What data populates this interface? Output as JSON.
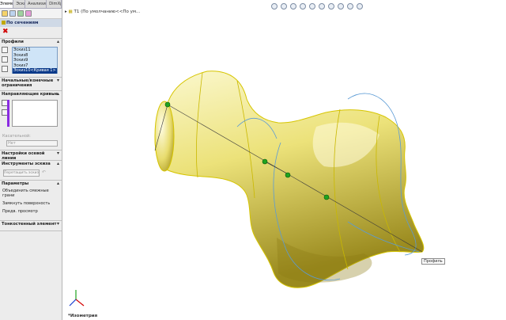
{
  "tabs": [
    "Элементы",
    "Эскиз",
    "Анализировать",
    "DimXpert"
  ],
  "property_manager": {
    "title": "По сечениям",
    "sections": {
      "profiles": {
        "header": "Профили",
        "items": [
          "Эскиз11",
          "Эскиз8",
          "Эскиз9",
          "Эскиз7",
          "Эскиз10<Кривая 1>"
        ]
      },
      "start_end": {
        "header": "Начальные/конечные ограничения"
      },
      "guides": {
        "header": "Направляющие кривые"
      },
      "tangency": {
        "label": "Касательной:",
        "value": "Нет"
      },
      "centerline": {
        "header": "Настройки осевой линии"
      },
      "sketch_tools": {
        "header": "Инструменты эскиза",
        "button": "Перетащить эскиз"
      },
      "options": {
        "header": "Параметры",
        "items": [
          "Объединить смежные грани",
          "Замкнуть поверхность",
          "Предв. просмотр"
        ]
      },
      "thin": {
        "header": "Тонкостенный элемент"
      }
    }
  },
  "tree": {
    "text": "T1 (По умолчанию<<По ум..."
  },
  "graphics": {
    "profile_label": "Профиль",
    "view_label": "*Изометрия"
  },
  "colors": {
    "body_light": "#fbf8cf",
    "body_mid": "#ece27a",
    "body_dark": "#9a8a1e",
    "edge": "#d6c500",
    "sketch": "#5b9bd5",
    "point": "#1fa31f",
    "accent": "#8a2be2"
  }
}
